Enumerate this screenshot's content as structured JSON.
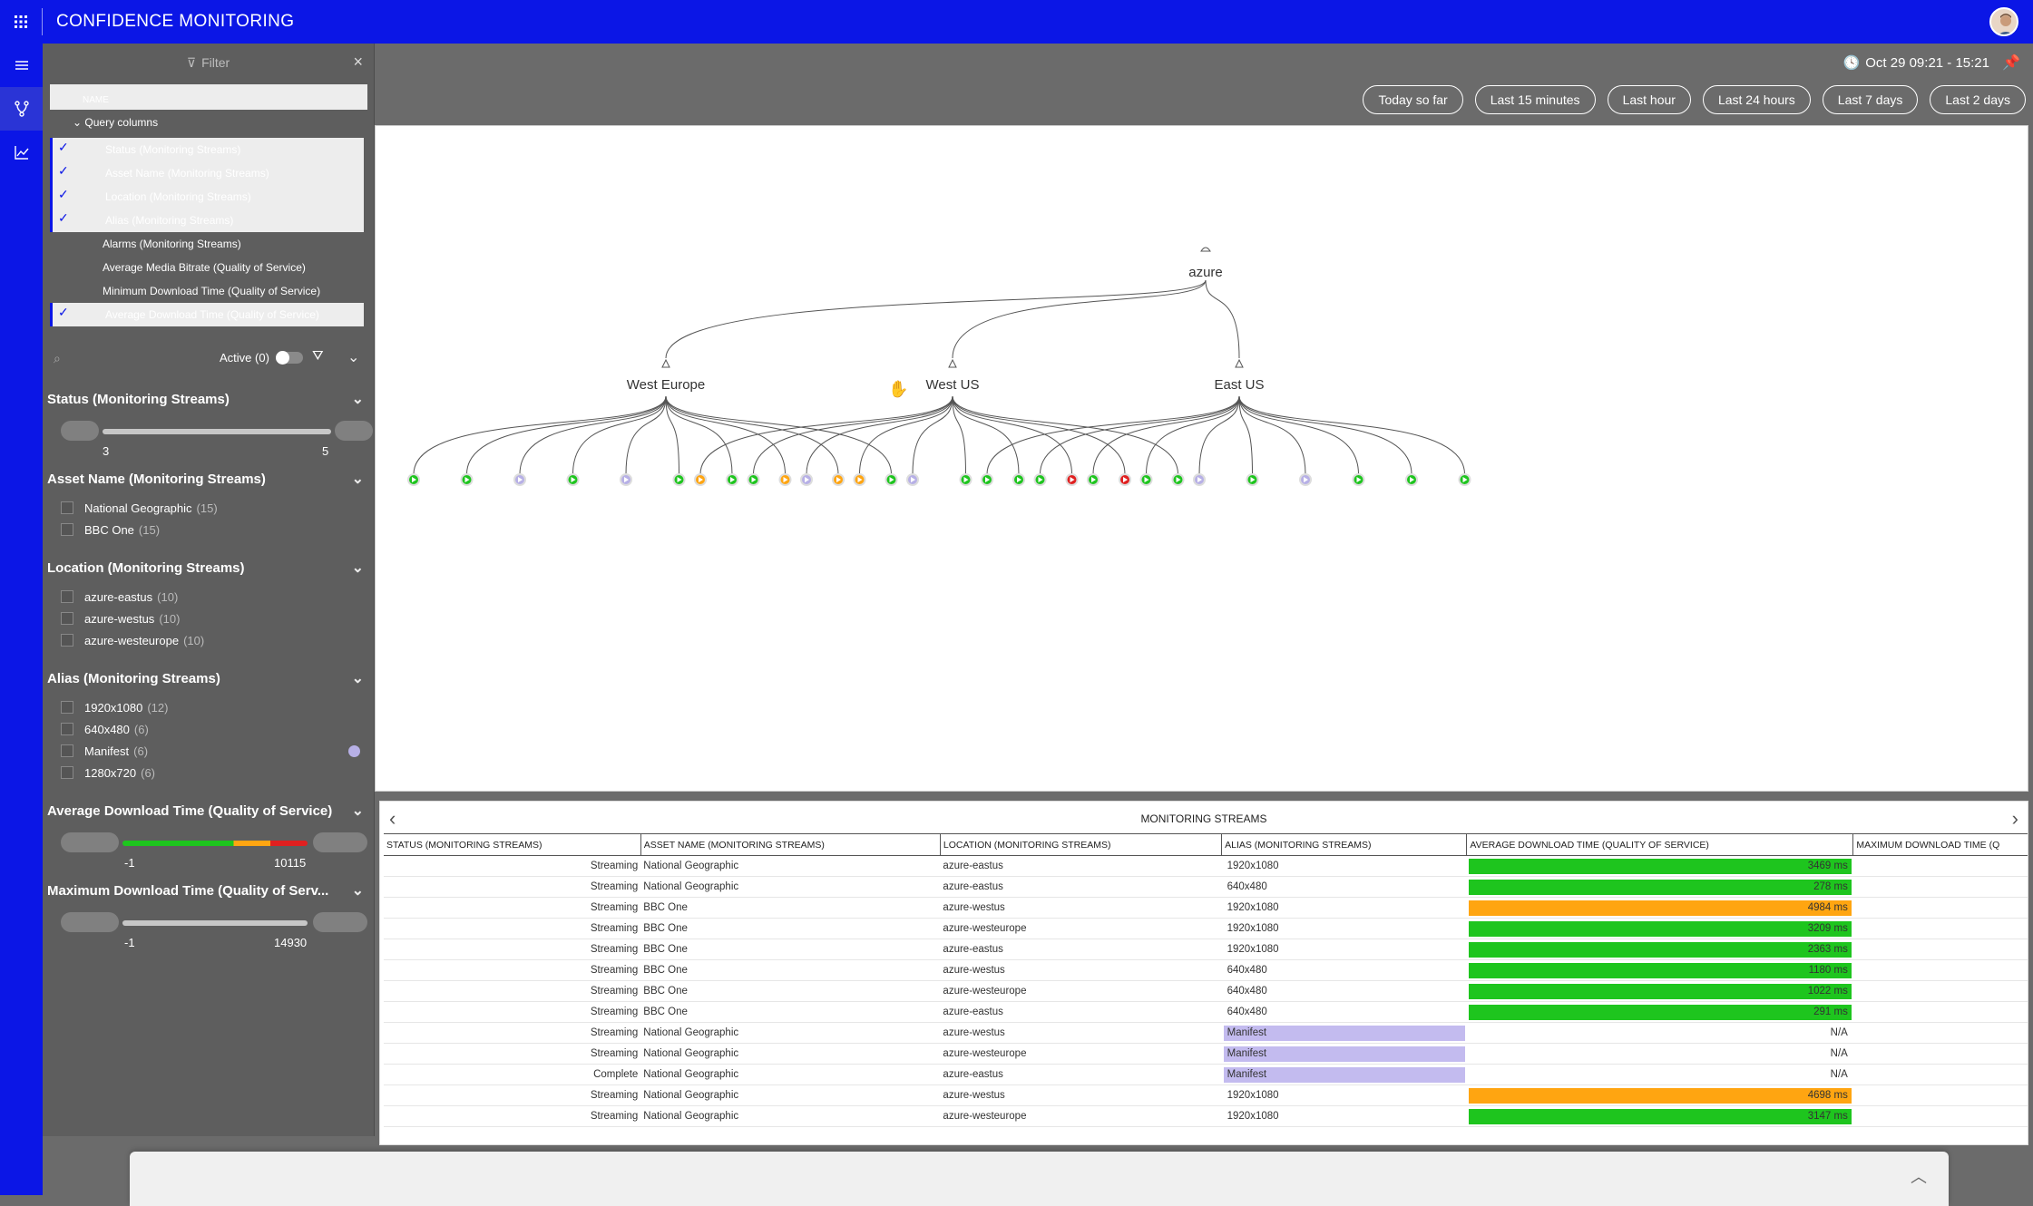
{
  "app": {
    "title": "CONFIDENCE MONITORING"
  },
  "filter_panel": {
    "filter_placeholder": "Filter",
    "name_header": "NAME",
    "query_group": "Query columns",
    "query_columns": [
      {
        "label": "Status (Monitoring Streams)",
        "selected": true
      },
      {
        "label": "Asset Name (Monitoring Streams)",
        "selected": true
      },
      {
        "label": "Location (Monitoring Streams)",
        "selected": true
      },
      {
        "label": "Alias (Monitoring Streams)",
        "selected": true
      },
      {
        "label": "Alarms (Monitoring Streams)",
        "selected": false
      },
      {
        "label": "Average Media Bitrate (Quality of Service)",
        "selected": false
      },
      {
        "label": "Minimum Download Time (Quality of Service)",
        "selected": false
      },
      {
        "label": "Average Download Time (Quality of Service)",
        "selected": true
      }
    ],
    "active_label": "Active (0)"
  },
  "filters": {
    "status": {
      "title": "Status (Monitoring Streams)",
      "min": "3",
      "max": "5"
    },
    "asset": {
      "title": "Asset Name (Monitoring Streams)",
      "items": [
        {
          "label": "National Geographic",
          "count": "(15)"
        },
        {
          "label": "BBC One",
          "count": "(15)"
        }
      ]
    },
    "location": {
      "title": "Location (Monitoring Streams)",
      "items": [
        {
          "label": "azure-eastus",
          "count": "(10)"
        },
        {
          "label": "azure-westus",
          "count": "(10)"
        },
        {
          "label": "azure-westeurope",
          "count": "(10)"
        }
      ]
    },
    "alias": {
      "title": "Alias (Monitoring Streams)",
      "items": [
        {
          "label": "1920x1080",
          "count": "(12)"
        },
        {
          "label": "640x480",
          "count": "(6)"
        },
        {
          "label": "Manifest",
          "count": "(6)"
        },
        {
          "label": "1280x720",
          "count": "(6)"
        }
      ]
    },
    "avg_dl": {
      "title": "Average Download Time (Quality of Service)",
      "min": "-1",
      "max": "10115"
    },
    "max_dl": {
      "title": "Maximum Download Time (Quality of Serv...",
      "min": "-1",
      "max": "14930"
    }
  },
  "timebar": {
    "range": "Oct 29 09:21 - 15:21",
    "buttons": [
      "Today so far",
      "Last 15 minutes",
      "Last hour",
      "Last 24 hours",
      "Last 7 days",
      "Last 2 days"
    ]
  },
  "tree": {
    "root": "azure",
    "regions": [
      {
        "name": "West Europe",
        "leaves": [
          "green",
          "green",
          "purple",
          "green",
          "purple",
          "green",
          "green",
          "orange",
          "orange",
          "green"
        ]
      },
      {
        "name": "West US",
        "leaves": [
          "orange",
          "green",
          "purple",
          "orange",
          "purple",
          "green",
          "green",
          "red",
          "red",
          "green"
        ]
      },
      {
        "name": "East US",
        "leaves": [
          "green",
          "green",
          "green",
          "green",
          "purple",
          "green",
          "purple",
          "green",
          "green",
          "green"
        ]
      }
    ]
  },
  "colors": {
    "green": "#1ec51e",
    "orange": "#ffa511",
    "red": "#e02020",
    "purple": "#b7b0e6",
    "brand": "#0b16e6"
  },
  "table": {
    "title": "MONITORING STREAMS",
    "columns": [
      "STATUS (MONITORING STREAMS)",
      "ASSET NAME (MONITORING STREAMS)",
      "LOCATION (MONITORING STREAMS)",
      "ALIAS (MONITORING STREAMS)",
      "AVERAGE DOWNLOAD TIME (QUALITY OF SERVICE)",
      "MAXIMUM DOWNLOAD TIME (Q"
    ],
    "rows": [
      [
        "Streaming",
        "National Geographic",
        "azure-eastus",
        "1920x1080",
        "3469 ms",
        "green"
      ],
      [
        "Streaming",
        "National Geographic",
        "azure-eastus",
        "640x480",
        "278 ms",
        "green"
      ],
      [
        "Streaming",
        "BBC One",
        "azure-westus",
        "1920x1080",
        "4984 ms",
        "orange"
      ],
      [
        "Streaming",
        "BBC One",
        "azure-westeurope",
        "1920x1080",
        "3209 ms",
        "green"
      ],
      [
        "Streaming",
        "BBC One",
        "azure-eastus",
        "1920x1080",
        "2363 ms",
        "green"
      ],
      [
        "Streaming",
        "BBC One",
        "azure-westus",
        "640x480",
        "1180 ms",
        "green"
      ],
      [
        "Streaming",
        "BBC One",
        "azure-westeurope",
        "640x480",
        "1022 ms",
        "green"
      ],
      [
        "Streaming",
        "BBC One",
        "azure-eastus",
        "640x480",
        "291 ms",
        "green"
      ],
      [
        "Streaming",
        "National Geographic",
        "azure-westus",
        "Manifest",
        "N/A",
        "na"
      ],
      [
        "Streaming",
        "National Geographic",
        "azure-westeurope",
        "Manifest",
        "N/A",
        "na"
      ],
      [
        "Complete",
        "National Geographic",
        "azure-eastus",
        "Manifest",
        "N/A",
        "na"
      ],
      [
        "Streaming",
        "National Geographic",
        "azure-westus",
        "1920x1080",
        "4698 ms",
        "orange"
      ],
      [
        "Streaming",
        "National Geographic",
        "azure-westeurope",
        "1920x1080",
        "3147 ms",
        "green"
      ]
    ]
  }
}
